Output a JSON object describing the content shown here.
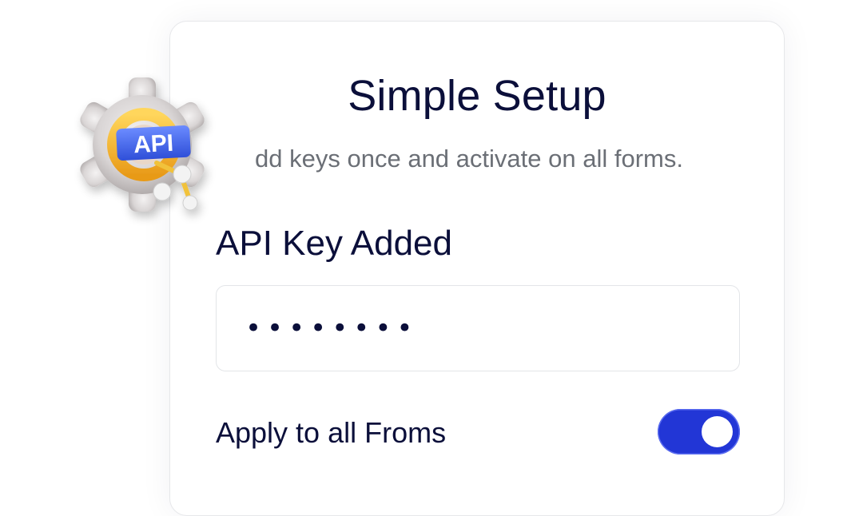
{
  "card": {
    "title": "Simple Setup",
    "subtitle": "dd keys once and activate on all forms."
  },
  "api_key": {
    "label": "API Key Added",
    "masked_value": "••••••••"
  },
  "apply_all": {
    "label": "Apply to all Froms",
    "enabled": true
  },
  "illustration": {
    "icon": "gear-api-icon",
    "badge_text": "API"
  },
  "colors": {
    "accent": "#2236d6",
    "text_dark": "#0b0f3a",
    "text_muted": "#6b6f76",
    "badge_blue": "#3f63ea",
    "ring_yellow": "#f5b92d"
  }
}
